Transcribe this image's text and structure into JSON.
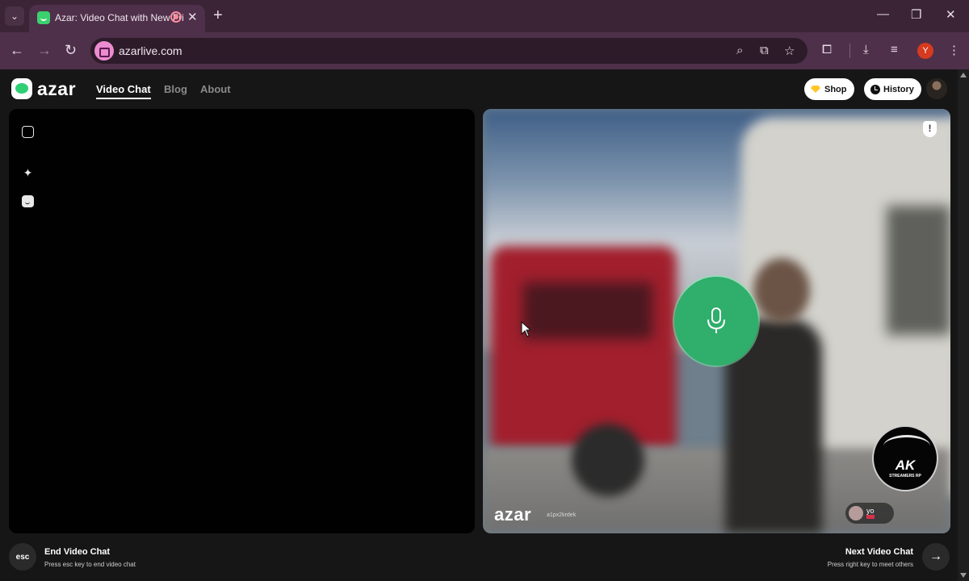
{
  "browser": {
    "tab_title": "Azar: Video Chat with New Fri",
    "url": "azarlive.com",
    "profile_initial": "Y",
    "controls": {
      "minimize": "—",
      "maximize": "❐",
      "close": "✕"
    }
  },
  "site": {
    "logo": "azar",
    "nav": [
      {
        "label": "Video Chat",
        "active": true
      },
      {
        "label": "Blog",
        "active": false
      },
      {
        "label": "About",
        "active": false
      }
    ],
    "shop_label": "Shop",
    "history_label": "History"
  },
  "video": {
    "watermark": "azar",
    "watermark_id": "a1px2krdek",
    "peer_name": "yo",
    "report_icon": "!"
  },
  "bottom": {
    "end_key": "esc",
    "end_title": "End Video Chat",
    "end_sub": "Press esc key to end video chat",
    "next_title": "Next Video Chat",
    "next_sub": "Press right key to meet others",
    "next_key": "→"
  },
  "overlay": {
    "emblem_text": "AK",
    "emblem_sub": "STREAMERS RP"
  },
  "colors": {
    "accent_green": "#2fae6c",
    "browser_frame": "#4e304a"
  }
}
